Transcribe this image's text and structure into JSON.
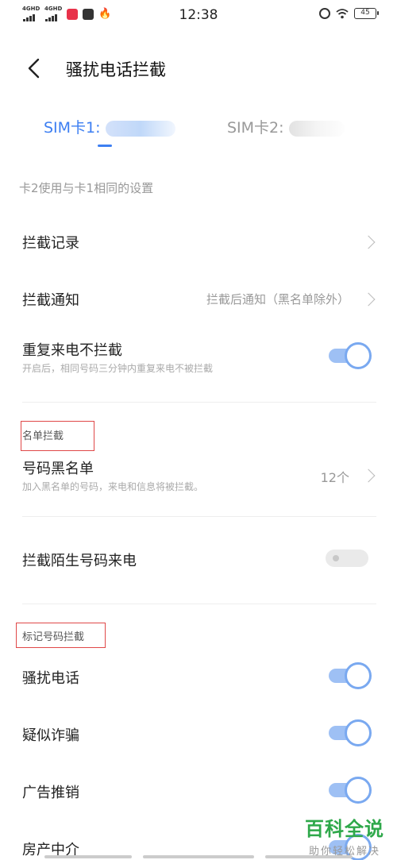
{
  "status_bar": {
    "network1": "4GHD",
    "network2": "4GHD",
    "time": "12:38",
    "battery": "45"
  },
  "header": {
    "title": "骚扰电话拦截"
  },
  "tabs": [
    {
      "label": "SIM卡1:",
      "active": true
    },
    {
      "label": "SIM卡2:",
      "active": false
    }
  ],
  "subnote": "卡2使用与卡1相同的设置",
  "rows": {
    "records": {
      "label": "拦截记录"
    },
    "notify": {
      "label": "拦截通知",
      "value": "拦截后通知（黑名单除外）"
    },
    "repeat_call": {
      "label": "重复来电不拦截",
      "desc": "开启后，相同号码三分钟内重复来电不被拦截",
      "enabled": true
    },
    "blacklist": {
      "label": "号码黑名单",
      "desc": "加入黑名单的号码，来电和信息将被拦截。",
      "value": "12个"
    },
    "stranger": {
      "label": "拦截陌生号码来电",
      "enabled": false
    },
    "harass": {
      "label": "骚扰电话",
      "enabled": true
    },
    "fraud": {
      "label": "疑似诈骗",
      "enabled": true
    },
    "ads": {
      "label": "广告推销",
      "enabled": true
    },
    "estate": {
      "label": "房产中介",
      "enabled": true
    }
  },
  "sections": {
    "list_block": "名单拦截",
    "mark_block": "标记号码拦截"
  },
  "watermark": {
    "main": "百科全说",
    "sub": "助你轻松解决"
  },
  "colors": {
    "accent": "#3d7ff2",
    "toggle_on": "#7aa9f0",
    "annotation": "#e04848",
    "watermark": "#2ea84a"
  }
}
